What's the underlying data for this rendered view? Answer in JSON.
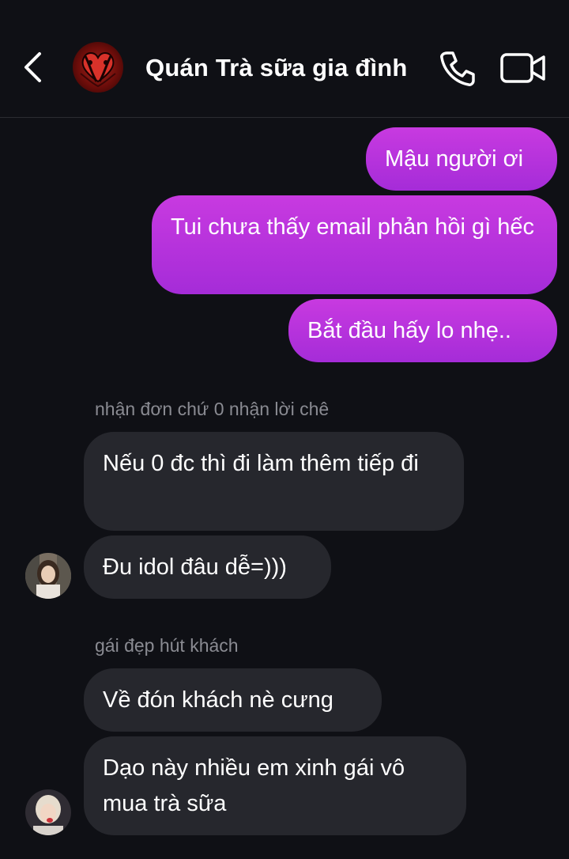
{
  "header": {
    "title": "Quán Trà sữa gia đình",
    "back_icon": "chevron-left-icon",
    "call_icon": "phone-icon",
    "video_icon": "video-camera-icon"
  },
  "messages": {
    "outgoing": [
      {
        "text": "Mậu người ơi"
      },
      {
        "text": "Tui chưa thấy email phản hồi gì hếc"
      },
      {
        "text": "Bắt đầu hấy lo nhẹ.."
      }
    ],
    "group1": {
      "sender": "nhận đơn chứ 0 nhận lời chê",
      "messages": [
        {
          "text": "Nếu 0 đc thì đi làm thêm tiếp đi"
        },
        {
          "text": "Đu idol đâu dễ=)))"
        }
      ]
    },
    "group2": {
      "sender": "gái đẹp hút khách",
      "messages": [
        {
          "text": "Về đón khách nè cưng"
        },
        {
          "text": "Dạo này nhiều em xinh gái vô mua trà sữa"
        }
      ]
    }
  },
  "colors": {
    "background": "#0f1015",
    "outgoing_bubble": "#b533dc",
    "incoming_bubble": "#26272d",
    "sender_name": "#8a8b92"
  }
}
